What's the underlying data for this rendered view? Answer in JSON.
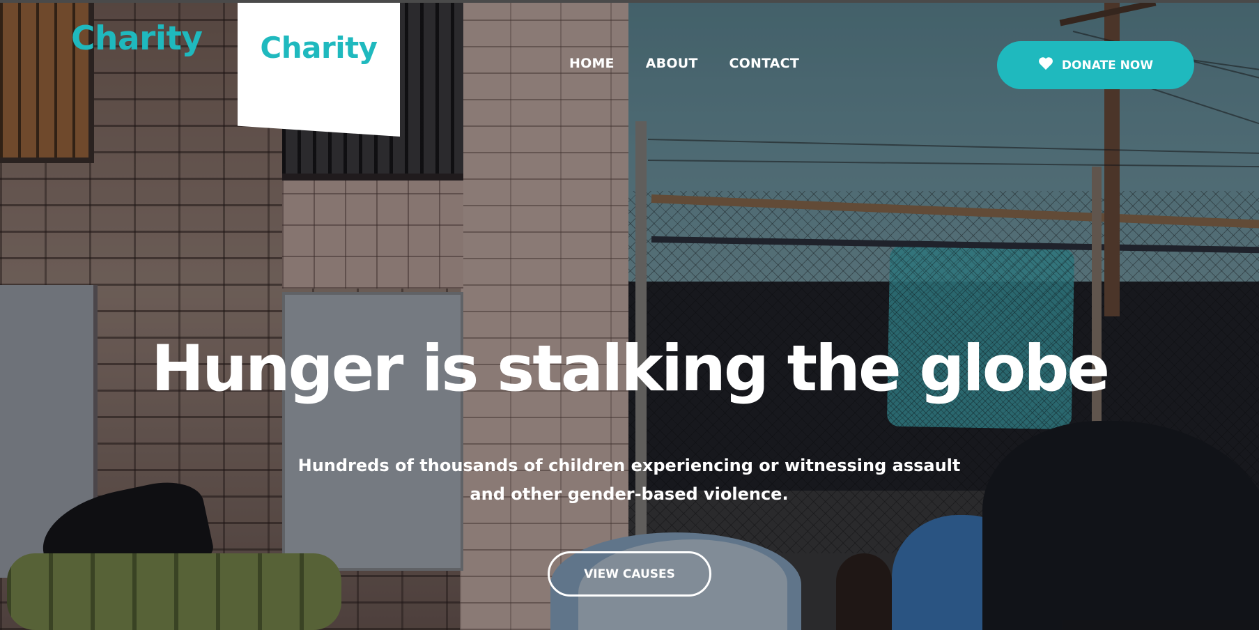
{
  "brand": {
    "logo_text": "Charity",
    "logo_card_text": "Charity",
    "accent_color": "#1fb9be"
  },
  "nav": {
    "items": [
      {
        "label": "HOME"
      },
      {
        "label": "ABOUT"
      },
      {
        "label": "CONTACT"
      }
    ]
  },
  "donate": {
    "label": "DONATE NOW",
    "icon": "heart-icon"
  },
  "hero": {
    "headline": "Hunger is stalking the globe",
    "subtitle_line1": "Hundreds of thousands of children experiencing or witnessing assault",
    "subtitle_line2": "and other gender-based violence.",
    "cta_label": "VIEW CAUSES"
  }
}
